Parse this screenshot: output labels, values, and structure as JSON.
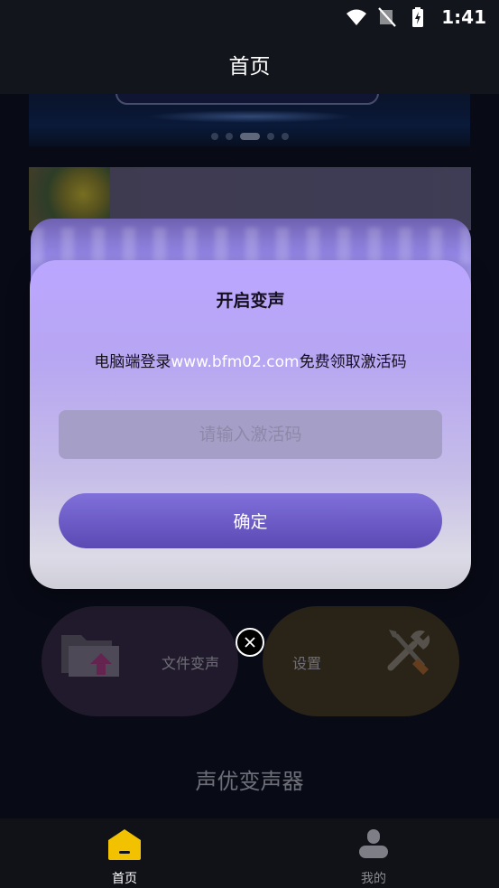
{
  "status_bar": {
    "time": "1:41",
    "icons": [
      "wifi-icon",
      "no-signal-icon",
      "battery-charging-icon"
    ]
  },
  "app_bar": {
    "title": "首页"
  },
  "banner": {
    "dots": 5,
    "active_dot": 3
  },
  "features": {
    "file_voice_label": "文件变声",
    "settings_label": "设置"
  },
  "app_name": "声优变声器",
  "bottom_nav": {
    "items": [
      {
        "label": "首页",
        "icon": "home-icon",
        "active": true
      },
      {
        "label": "我的",
        "icon": "person-icon",
        "active": false
      }
    ]
  },
  "dialog": {
    "title": "开启变声",
    "message_prefix": "电脑端登录",
    "message_site": "www.bfm02.com",
    "message_suffix": "免费领取激活码",
    "input_value": "",
    "input_placeholder": "请输入激活码",
    "confirm_label": "确定",
    "close_icon": "close-icon"
  },
  "colors": {
    "accent": "#5b49b4",
    "dialog_top": "#bba6ff",
    "nav_active_icon": "#f2c200"
  }
}
